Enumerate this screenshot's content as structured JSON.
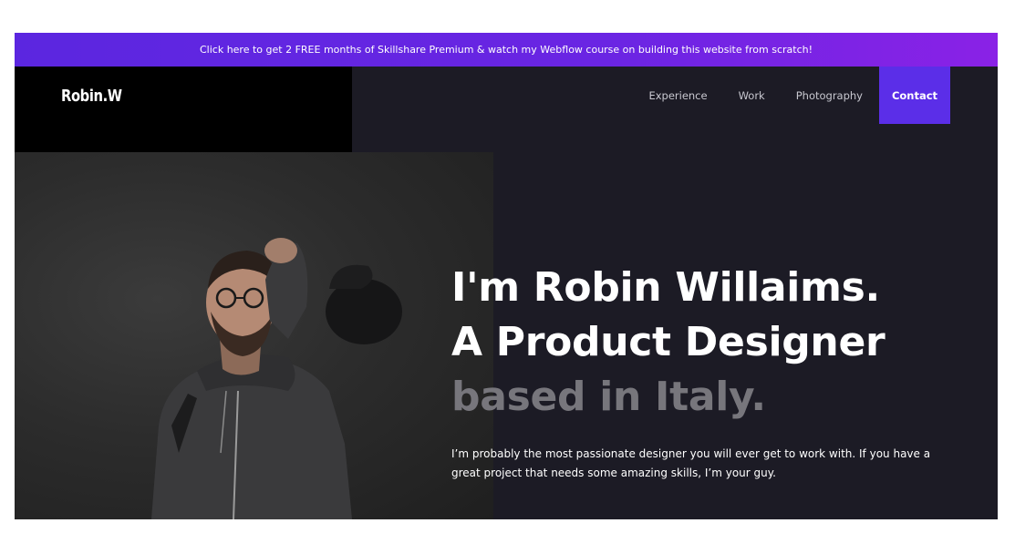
{
  "promo": {
    "text": "Click here to get 2 FREE months of Skillshare Premium & watch my Webflow course on building this website from scratch!"
  },
  "brand": {
    "logo": "Robin.W"
  },
  "nav": {
    "items": [
      {
        "label": "Experience"
      },
      {
        "label": "Work"
      },
      {
        "label": "Photography"
      }
    ],
    "contact_label": "Contact"
  },
  "hero": {
    "line1": "I'm Robin Willaims.",
    "line2": "A Product Designer",
    "line3": "based in Italy.",
    "description": "I’m probably the most passionate designer you will ever get to work with. If you have a great project that needs some amazing skills, I’m your guy."
  },
  "colors": {
    "background": "#1c1b25",
    "accent": "#5b2ee8",
    "promo_start": "#5b26e0",
    "promo_end": "#8a22e6",
    "muted_text": "#77767c"
  }
}
